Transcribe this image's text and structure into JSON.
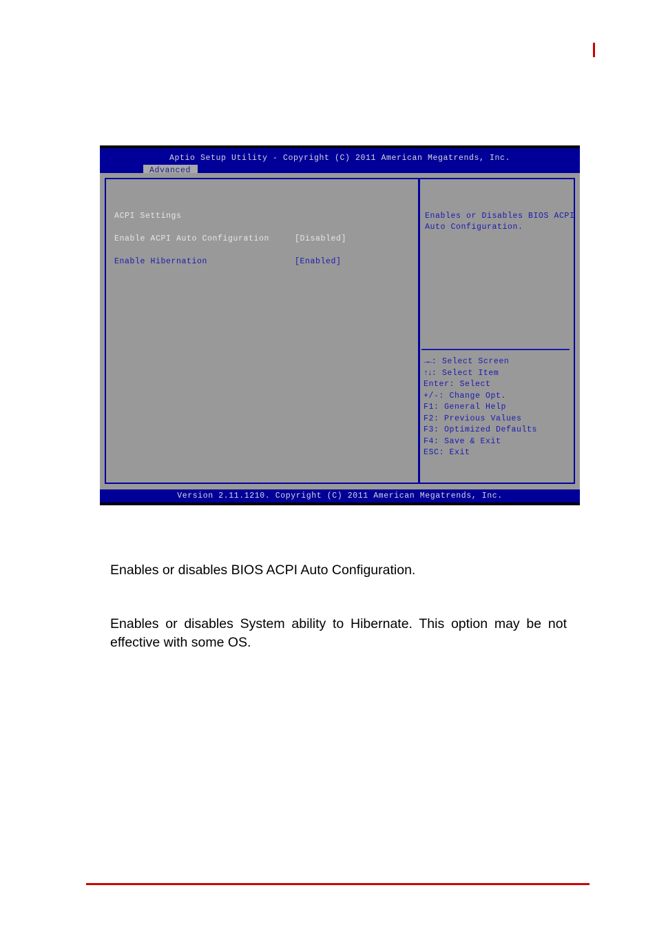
{
  "page": {
    "change_bar_color": "#cc0000",
    "footer_rule_color": "#cc0000"
  },
  "bios": {
    "colors": {
      "background": "#999999",
      "title_bar": "#000099",
      "border": "#0000a0",
      "text_light": "#e6e6e6",
      "text_blue": "#1a1ab0",
      "tab_background": "#a9a9a9"
    },
    "title": "Aptio Setup Utility - Copyright (C) 2011 American Megatrends, Inc.",
    "tab": {
      "label": "Advanced"
    },
    "section_title": "ACPI Settings",
    "options": [
      {
        "label": "Enable ACPI Auto Configuration",
        "value": "[Disabled]",
        "selected": false
      },
      {
        "label": "Enable Hibernation",
        "value": "[Enabled]",
        "selected": true
      }
    ],
    "help": {
      "line1": "Enables or Disables BIOS ACPI",
      "line2": "Auto Configuration."
    },
    "key_legend": [
      {
        "key": "→←",
        "label": ": Select Screen"
      },
      {
        "key": "↑↓",
        "label": ": Select Item"
      },
      {
        "key": "Enter",
        "label": ": Select"
      },
      {
        "key": "+/-",
        "label": ": Change Opt."
      },
      {
        "key": "F1",
        "label": ": General Help"
      },
      {
        "key": "F2",
        "label": ": Previous Values"
      },
      {
        "key": "F3",
        "label": ": Optimized Defaults"
      },
      {
        "key": "F4",
        "label": ": Save & Exit"
      },
      {
        "key": "ESC",
        "label": ": Exit"
      }
    ],
    "version": "Version 2.11.1210. Copyright (C) 2011 American Megatrends, Inc."
  },
  "document": {
    "paragraphs": [
      "Enables or disables BIOS ACPI Auto Configuration.",
      "Enables or disables System ability to Hibernate. This option may be not effective with some OS."
    ]
  }
}
